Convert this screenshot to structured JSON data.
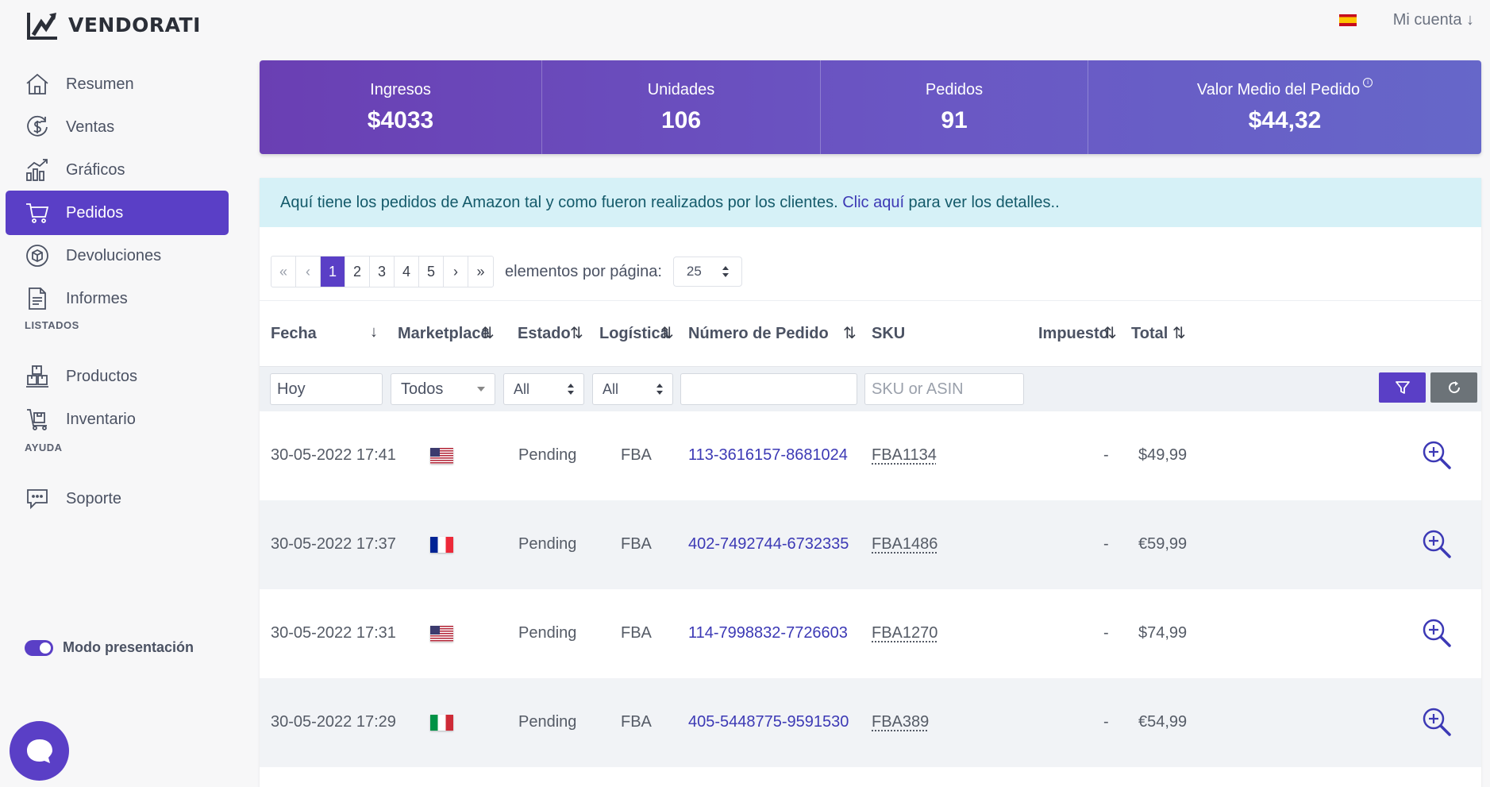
{
  "app": {
    "brand": "VENDORATI"
  },
  "header": {
    "account_label": "Mi cuenta ↓",
    "language_flag": "es"
  },
  "sidebar": {
    "items": [
      {
        "label": "Resumen",
        "icon": "home-icon"
      },
      {
        "label": "Ventas",
        "icon": "dollar-icon"
      },
      {
        "label": "Gráficos",
        "icon": "chart-icon"
      },
      {
        "label": "Pedidos",
        "icon": "cart-icon",
        "active": true
      },
      {
        "label": "Devoluciones",
        "icon": "return-box-icon"
      },
      {
        "label": "Informes",
        "icon": "document-icon"
      }
    ],
    "section_listados": "LISTADOS",
    "listados_items": [
      {
        "label": "Productos",
        "icon": "boxes-icon"
      },
      {
        "label": "Inventario",
        "icon": "trolley-icon"
      }
    ],
    "section_ayuda": "AYUDA",
    "ayuda_items": [
      {
        "label": "Soporte",
        "icon": "chat-icon"
      }
    ],
    "presentation_mode": {
      "label": "Modo presentación",
      "on": true
    }
  },
  "stats": [
    {
      "label": "Ingresos",
      "value": "$4033"
    },
    {
      "label": "Unidades",
      "value": "106"
    },
    {
      "label": "Pedidos",
      "value": "91"
    },
    {
      "label": "Valor Medio del Pedido",
      "value": "$44,32",
      "info": true
    }
  ],
  "alert": {
    "text_before": "Aquí tiene los pedidos de Amazon tal y como fueron realizados por los clientes. ",
    "link_text": "Clic aquí",
    "text_after": " para ver los detalles.."
  },
  "pagination": {
    "first": "«",
    "prev": "‹",
    "pages": [
      "1",
      "2",
      "3",
      "4",
      "5"
    ],
    "current": "1",
    "next": "›",
    "last": "»",
    "per_page_label": "elementos por página:",
    "per_page_value": "25"
  },
  "table": {
    "columns": {
      "fecha": "Fecha",
      "marketplace": "Marketplace",
      "estado": "Estado",
      "logistica": "Logística",
      "numero": "Número de Pedido",
      "sku": "SKU",
      "impuesto": "Impuesto",
      "total": "Total"
    },
    "sort_icons": {
      "fecha": "↓",
      "other": "⇅"
    },
    "filters": {
      "fecha_value": "Hoy",
      "marketplace_value": "Todos",
      "estado_value": "All",
      "logistica_value": "All",
      "numero_value": "",
      "sku_placeholder": "SKU or ASIN"
    },
    "rows": [
      {
        "fecha": "30-05-2022 17:41",
        "marketplace": "us",
        "estado": "Pending",
        "logistica": "FBA",
        "numero": "113-3616157-8681024",
        "sku": "FBA1134",
        "impuesto": "-",
        "total": "$49,99"
      },
      {
        "fecha": "30-05-2022 17:37",
        "marketplace": "fr",
        "estado": "Pending",
        "logistica": "FBA",
        "numero": "402-7492744-6732335",
        "sku": "FBA1486",
        "impuesto": "-",
        "total": "€59,99"
      },
      {
        "fecha": "30-05-2022 17:31",
        "marketplace": "us",
        "estado": "Pending",
        "logistica": "FBA",
        "numero": "114-7998832-7726603",
        "sku": "FBA1270",
        "impuesto": "-",
        "total": "$74,99"
      },
      {
        "fecha": "30-05-2022 17:29",
        "marketplace": "it",
        "estado": "Pending",
        "logistica": "FBA",
        "numero": "405-5448775-9591530",
        "sku": "FBA389",
        "impuesto": "-",
        "total": "€54,99"
      }
    ]
  },
  "colors": {
    "accent": "#5a3fc6",
    "link": "#3c39b5",
    "alert_bg": "#d6f1f7"
  }
}
